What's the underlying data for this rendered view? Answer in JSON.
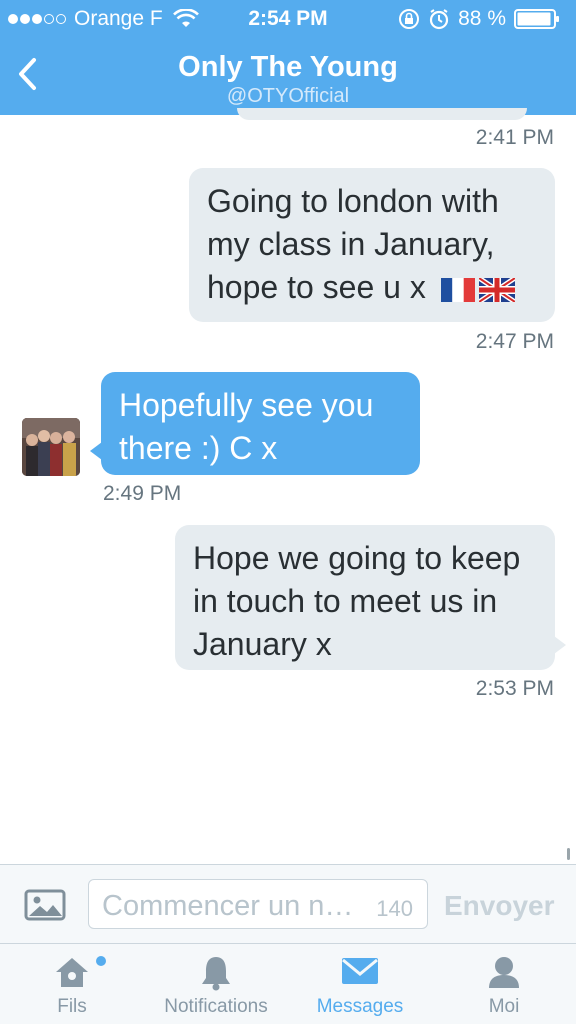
{
  "status_bar": {
    "carrier": "Orange F",
    "time": "2:54 PM",
    "battery": "88 %"
  },
  "header": {
    "title": "Only The Young",
    "handle": "@OTYOfficial"
  },
  "messages": [
    {
      "time": "2:41 PM"
    },
    {
      "direction": "sent",
      "text": "Going to london with my class in January, hope to see u x",
      "time": "2:47 PM"
    },
    {
      "direction": "received",
      "text": "Hopefully see you there :) C x",
      "time": "2:49 PM"
    },
    {
      "direction": "sent",
      "text": "Hope we going to keep in touch to meet us in January x",
      "time": "2:53 PM"
    }
  ],
  "composer": {
    "placeholder": "Commencer un n…",
    "char_count": "140",
    "send_label": "Envoyer"
  },
  "tabs": [
    {
      "label": "Fils",
      "icon": "home-icon"
    },
    {
      "label": "Notifications",
      "icon": "bell-icon"
    },
    {
      "label": "Messages",
      "icon": "envelope-icon",
      "active": true
    },
    {
      "label": "Moi",
      "icon": "person-icon"
    }
  ],
  "colors": {
    "accent": "#55acee",
    "sent_bubble": "#e6ecf0",
    "timestamp": "#66757f"
  }
}
